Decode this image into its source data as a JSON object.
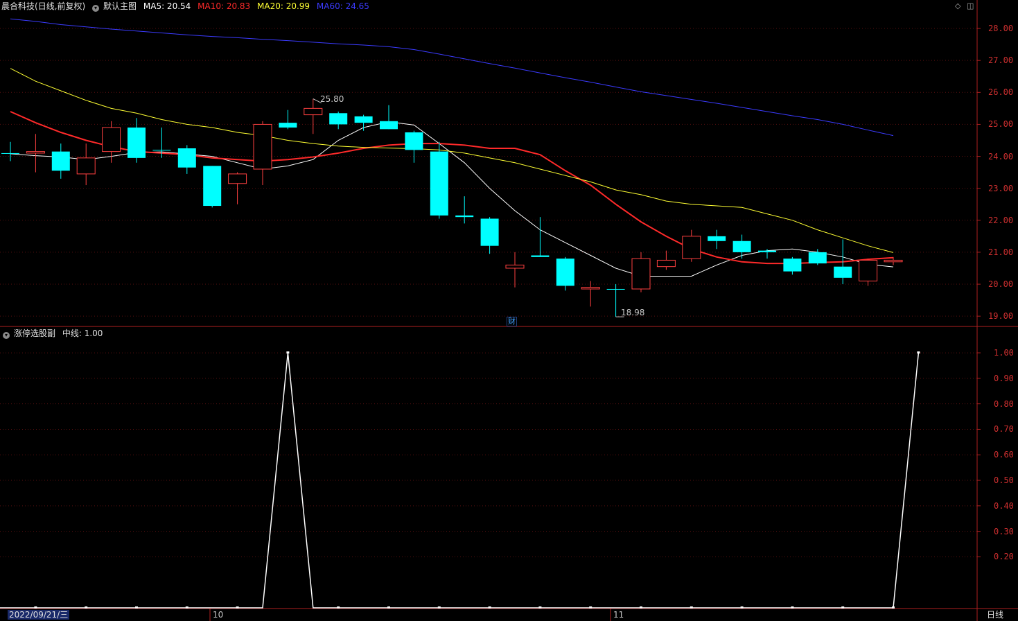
{
  "header": {
    "stock_name": "晨合科技",
    "mode": "(日线,前复权)",
    "main_title": "默认主图",
    "ma": [
      {
        "label": "MA5: 20.54",
        "color": "#ffffff"
      },
      {
        "label": "MA10: 20.83",
        "color": "#ff2a2a"
      },
      {
        "label": "MA20: 20.99",
        "color": "#ffff33"
      },
      {
        "label": "MA60: 24.65",
        "color": "#3b3bff"
      }
    ]
  },
  "sub_header": {
    "title": "涨停选股副",
    "mid_line": "中线: 1.00"
  },
  "annotations": {
    "high_label": "25.80",
    "low_label": "18.98",
    "fin_badge": "财"
  },
  "footer": {
    "date_label": "2022/09/21/三",
    "month1": "10",
    "month2": "11",
    "period": "日线"
  },
  "colors": {
    "up": "#ff4040",
    "down": "#00ffff",
    "axis": "#b02020",
    "grid": "#5a1010"
  },
  "chart_data": [
    {
      "type": "candlestick",
      "ylim": [
        18.7,
        28.5
      ],
      "yticks": [
        "28.00",
        "27.00",
        "26.00",
        "25.00",
        "24.00",
        "23.00",
        "22.00",
        "21.00",
        "20.00",
        "19.00"
      ],
      "grid": true,
      "candles": [
        {
          "o": 24.1,
          "h": 24.45,
          "l": 23.85,
          "c": 24.1
        },
        {
          "o": 24.1,
          "h": 24.7,
          "l": 23.5,
          "c": 24.15
        },
        {
          "o": 24.15,
          "h": 24.4,
          "l": 23.3,
          "c": 23.55
        },
        {
          "o": 23.45,
          "h": 24.4,
          "l": 23.1,
          "c": 23.95
        },
        {
          "o": 24.15,
          "h": 25.1,
          "l": 23.8,
          "c": 24.9
        },
        {
          "o": 24.9,
          "h": 25.2,
          "l": 23.8,
          "c": 23.95
        },
        {
          "o": 24.2,
          "h": 24.9,
          "l": 23.95,
          "c": 24.2
        },
        {
          "o": 24.25,
          "h": 24.35,
          "l": 23.45,
          "c": 23.65
        },
        {
          "o": 23.7,
          "h": 23.7,
          "l": 22.4,
          "c": 22.45
        },
        {
          "o": 23.15,
          "h": 23.5,
          "l": 22.5,
          "c": 23.45
        },
        {
          "o": 23.6,
          "h": 25.1,
          "l": 23.1,
          "c": 25.0
        },
        {
          "o": 25.05,
          "h": 25.45,
          "l": 24.85,
          "c": 24.9
        },
        {
          "o": 25.3,
          "h": 25.8,
          "l": 24.7,
          "c": 25.5
        },
        {
          "o": 25.35,
          "h": 25.4,
          "l": 24.85,
          "c": 25.0
        },
        {
          "o": 25.25,
          "h": 25.3,
          "l": 24.8,
          "c": 25.05
        },
        {
          "o": 25.1,
          "h": 25.6,
          "l": 24.85,
          "c": 24.85
        },
        {
          "o": 24.75,
          "h": 24.8,
          "l": 23.8,
          "c": 24.2
        },
        {
          "o": 24.15,
          "h": 24.45,
          "l": 22.05,
          "c": 22.15
        },
        {
          "o": 22.15,
          "h": 22.75,
          "l": 21.9,
          "c": 22.1
        },
        {
          "o": 22.05,
          "h": 22.1,
          "l": 20.95,
          "c": 21.2
        },
        {
          "o": 20.5,
          "h": 21.0,
          "l": 19.9,
          "c": 20.6
        },
        {
          "o": 20.9,
          "h": 22.1,
          "l": 20.85,
          "c": 20.85
        },
        {
          "o": 20.8,
          "h": 20.85,
          "l": 19.8,
          "c": 19.95
        },
        {
          "o": 19.85,
          "h": 20.1,
          "l": 19.3,
          "c": 19.9
        },
        {
          "o": 19.85,
          "h": 20.0,
          "l": 18.98,
          "c": 19.85
        },
        {
          "o": 19.85,
          "h": 21.0,
          "l": 19.75,
          "c": 20.8
        },
        {
          "o": 20.55,
          "h": 21.05,
          "l": 20.45,
          "c": 20.75
        },
        {
          "o": 20.8,
          "h": 21.7,
          "l": 20.7,
          "c": 21.5
        },
        {
          "o": 21.5,
          "h": 21.7,
          "l": 21.1,
          "c": 21.35
        },
        {
          "o": 21.35,
          "h": 21.55,
          "l": 20.8,
          "c": 21.0
        },
        {
          "o": 21.05,
          "h": 21.1,
          "l": 20.8,
          "c": 21.0
        },
        {
          "o": 20.8,
          "h": 20.85,
          "l": 20.3,
          "c": 20.4
        },
        {
          "o": 21.0,
          "h": 21.1,
          "l": 20.6,
          "c": 20.65
        },
        {
          "o": 20.55,
          "h": 21.4,
          "l": 20.0,
          "c": 20.2
        },
        {
          "o": 20.1,
          "h": 20.8,
          "l": 19.95,
          "c": 20.75
        },
        {
          "o": 20.7,
          "h": 20.85,
          "l": 20.6,
          "c": 20.75
        }
      ],
      "series": [
        {
          "name": "MA5",
          "color": "#ffffff",
          "values": [
            24.08,
            24.02,
            23.98,
            23.9,
            24.0,
            24.12,
            24.14,
            24.07,
            24.0,
            23.8,
            23.6,
            23.7,
            23.9,
            24.5,
            24.9,
            25.08,
            24.98,
            24.4,
            23.8,
            23.0,
            22.3,
            21.7,
            21.3,
            20.9,
            20.5,
            20.25,
            20.25,
            20.25,
            20.6,
            20.9,
            21.05,
            21.1,
            21.0,
            20.85,
            20.62,
            20.54
          ]
        },
        {
          "name": "MA10",
          "color": "#ff2a2a",
          "values": [
            25.4,
            25.05,
            24.75,
            24.5,
            24.3,
            24.15,
            24.1,
            24.05,
            23.95,
            23.9,
            23.85,
            23.9,
            23.98,
            24.1,
            24.25,
            24.35,
            24.4,
            24.4,
            24.35,
            24.25,
            24.25,
            24.05,
            23.55,
            23.1,
            22.5,
            21.95,
            21.5,
            21.1,
            20.85,
            20.7,
            20.65,
            20.65,
            20.68,
            20.7,
            20.78,
            20.83
          ]
        },
        {
          "name": "MA20",
          "color": "#ffff33",
          "values": [
            26.75,
            26.35,
            26.05,
            25.75,
            25.5,
            25.35,
            25.15,
            25.0,
            24.9,
            24.75,
            24.65,
            24.5,
            24.4,
            24.32,
            24.28,
            24.26,
            24.24,
            24.2,
            24.1,
            23.95,
            23.8,
            23.6,
            23.4,
            23.2,
            22.95,
            22.8,
            22.6,
            22.5,
            22.45,
            22.4,
            22.2,
            22.0,
            21.7,
            21.45,
            21.2,
            20.99
          ]
        },
        {
          "name": "MA60",
          "color": "#3b3bff",
          "values": [
            28.3,
            28.22,
            28.12,
            28.05,
            27.98,
            27.92,
            27.86,
            27.8,
            27.75,
            27.71,
            27.66,
            27.62,
            27.57,
            27.52,
            27.48,
            27.43,
            27.34,
            27.2,
            27.05,
            26.9,
            26.76,
            26.61,
            26.46,
            26.32,
            26.17,
            26.02,
            25.9,
            25.78,
            25.66,
            25.53,
            25.4,
            25.27,
            25.15,
            25.0,
            24.82,
            24.65
          ]
        }
      ]
    },
    {
      "type": "line",
      "name": "涨停选股副",
      "ylim": [
        0,
        1.06
      ],
      "yticks": [
        "1.00",
        "0.90",
        "0.80",
        "0.70",
        "0.60",
        "0.50",
        "0.40",
        "0.30",
        "0.20"
      ],
      "values": [
        0,
        0,
        0,
        0,
        0,
        0,
        0,
        0,
        0,
        0,
        1,
        0,
        0,
        0,
        0,
        0,
        0,
        0,
        0,
        0,
        0,
        0,
        0,
        0,
        0,
        0,
        0,
        0,
        0,
        0,
        0,
        0,
        0,
        0,
        0,
        1
      ]
    }
  ]
}
